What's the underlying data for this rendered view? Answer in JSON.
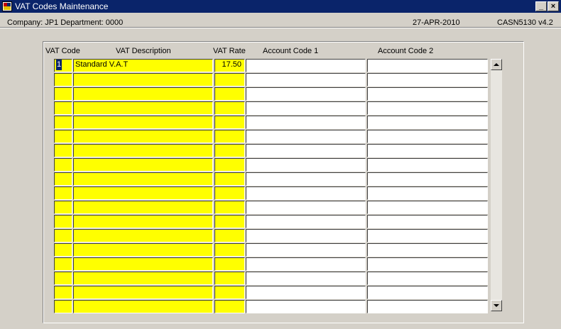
{
  "window": {
    "title": "VAT Codes Maintenance",
    "minimize_label": "_",
    "close_label": "×"
  },
  "info": {
    "company": "Company:  JP1    Department:  0000",
    "date": "27-APR-2010",
    "form_code": "CASN5130  v4.2"
  },
  "columns": {
    "vat_code": "VAT Code",
    "vat_description": "VAT Description",
    "vat_rate": "VAT Rate",
    "account_code_1": "Account Code 1",
    "account_code_2": "Account Code 2"
  },
  "rows": [
    {
      "code": "1",
      "description": "Standard V.A.T",
      "rate": "17.50",
      "account1": "",
      "account2": ""
    },
    {
      "code": "",
      "description": "",
      "rate": "",
      "account1": "",
      "account2": ""
    },
    {
      "code": "",
      "description": "",
      "rate": "",
      "account1": "",
      "account2": ""
    },
    {
      "code": "",
      "description": "",
      "rate": "",
      "account1": "",
      "account2": ""
    },
    {
      "code": "",
      "description": "",
      "rate": "",
      "account1": "",
      "account2": ""
    },
    {
      "code": "",
      "description": "",
      "rate": "",
      "account1": "",
      "account2": ""
    },
    {
      "code": "",
      "description": "",
      "rate": "",
      "account1": "",
      "account2": ""
    },
    {
      "code": "",
      "description": "",
      "rate": "",
      "account1": "",
      "account2": ""
    },
    {
      "code": "",
      "description": "",
      "rate": "",
      "account1": "",
      "account2": ""
    },
    {
      "code": "",
      "description": "",
      "rate": "",
      "account1": "",
      "account2": ""
    },
    {
      "code": "",
      "description": "",
      "rate": "",
      "account1": "",
      "account2": ""
    },
    {
      "code": "",
      "description": "",
      "rate": "",
      "account1": "",
      "account2": ""
    },
    {
      "code": "",
      "description": "",
      "rate": "",
      "account1": "",
      "account2": ""
    },
    {
      "code": "",
      "description": "",
      "rate": "",
      "account1": "",
      "account2": ""
    },
    {
      "code": "",
      "description": "",
      "rate": "",
      "account1": "",
      "account2": ""
    },
    {
      "code": "",
      "description": "",
      "rate": "",
      "account1": "",
      "account2": ""
    },
    {
      "code": "",
      "description": "",
      "rate": "",
      "account1": "",
      "account2": ""
    },
    {
      "code": "",
      "description": "",
      "rate": "",
      "account1": "",
      "account2": ""
    }
  ],
  "colors": {
    "title_bar": "#0a246a",
    "mandatory_field": "#ffff00",
    "optional_field": "#ffffff",
    "window_background": "#d4d0c8"
  }
}
